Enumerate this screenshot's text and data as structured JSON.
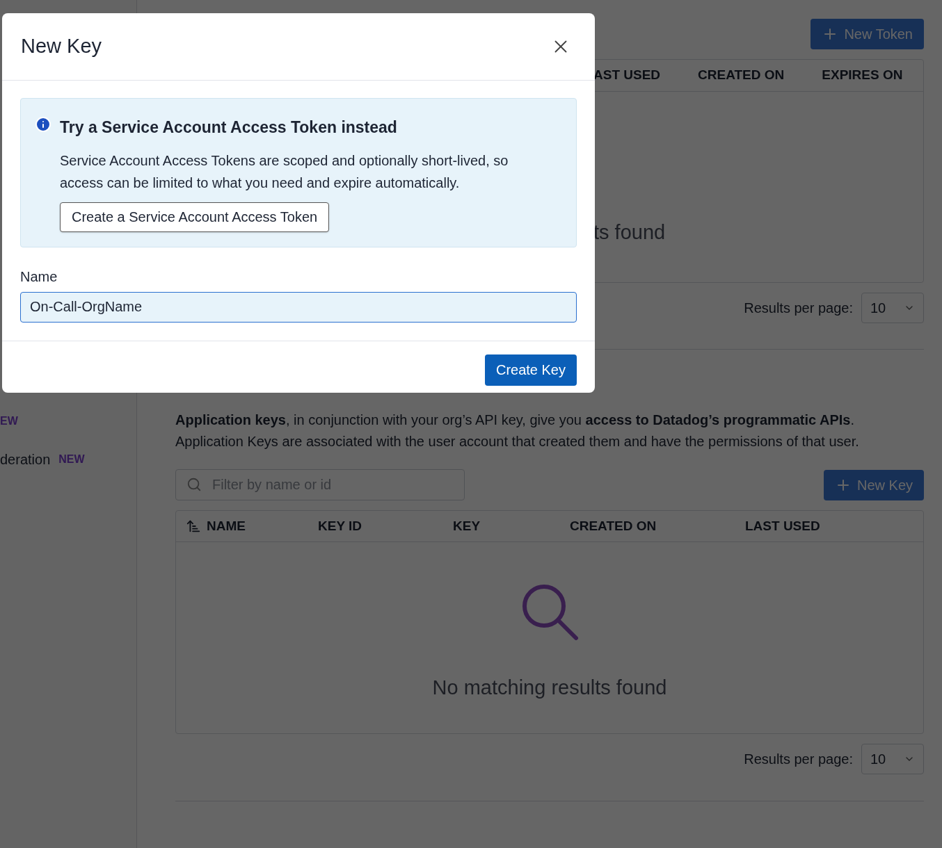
{
  "sidebar": {
    "items": [
      {
        "badge": "EW"
      },
      {
        "label": "deration",
        "badge": "NEW"
      }
    ]
  },
  "tokens_section": {
    "new_button": "New Token",
    "columns": [
      "AST USED",
      "CREATED ON",
      "EXPIRES ON"
    ],
    "empty_text": "ts found",
    "results_label": "Results per page:",
    "per_page": "10"
  },
  "app_keys_section": {
    "description": "**Application keys**, in conjunction with your org’s API key, give you **access to Datadog’s programmatic APIs**. Application Keys are associated with the user account that created them and have the permissions of that user.",
    "filter_placeholder": "Filter by name or id",
    "new_button": "New Key",
    "columns": [
      {
        "label": "NAME",
        "sorted": true
      },
      {
        "label": "KEY ID",
        "sorted": false
      },
      {
        "label": "KEY",
        "sorted": false
      },
      {
        "label": "CREATED ON",
        "sorted": false
      },
      {
        "label": "LAST USED",
        "sorted": false
      }
    ],
    "empty_text": "No matching results found",
    "results_label": "Results per page:",
    "per_page": "10"
  },
  "modal": {
    "title": "New Key",
    "callout": {
      "title": "Try a Service Account Access Token instead",
      "text": "Service Account Access Tokens are scoped and optionally short-lived, so access can be limited to what you need and expire automatically.",
      "button": "Create a Service Account Access Token"
    },
    "name_label": "Name",
    "name_value": "On-Call-OrgName",
    "submit": "Create Key"
  }
}
